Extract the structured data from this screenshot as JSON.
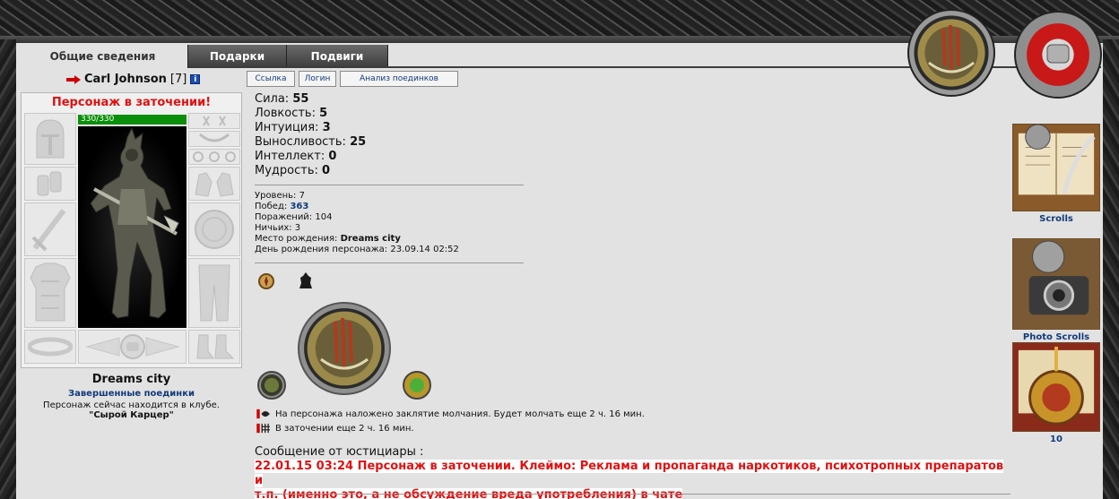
{
  "tabs": [
    {
      "label": "Общие сведения",
      "active": true
    },
    {
      "label": "Подарки",
      "active": false
    },
    {
      "label": "Подвиги",
      "active": false
    }
  ],
  "character": {
    "name": "Carl Johnson",
    "level": "[7]",
    "info_icon": "i",
    "hp": "330/330"
  },
  "buttons": {
    "link": "Ссылка",
    "login": "Логин",
    "battle_analysis": "Анализ поединков"
  },
  "jail_title": "Персонаж в заточении!",
  "city": "Dreams city",
  "finished_battles": "Завершенные поединки",
  "club_line": "Персонаж сейчас находится в клубе.",
  "club_name": "\"Сырой Карцер\"",
  "stats": [
    {
      "label": "Сила:",
      "value": "55"
    },
    {
      "label": "Ловкость:",
      "value": "5"
    },
    {
      "label": "Интуиция:",
      "value": "3"
    },
    {
      "label": "Выносливость:",
      "value": "25"
    },
    {
      "label": "Интеллект:",
      "value": "0"
    },
    {
      "label": "Мудрость:",
      "value": "0"
    }
  ],
  "info": {
    "level_label": "Уровень:",
    "level_value": "7",
    "wins_label": "Побед:",
    "wins_value": "363",
    "losses_label": "Поражений:",
    "losses_value": "104",
    "draws_label": "Ничьих:",
    "draws_value": "3",
    "birthplace_label": "Место рождения:",
    "birthplace_value": "Dreams city",
    "birthday_label": "День рождения персонажа:",
    "birthday_value": "23.09.14 02:52"
  },
  "effects": [
    "На персонажа наложено заклятие молчания. Будет молчать еще 2 ч. 16 мин.",
    "В заточении еще 2 ч. 16 мин."
  ],
  "message_label": "Сообщение от юстициары :",
  "message_line1": "22.01.15 03:24 Персонаж в заточении. Клеймо: Реклама и пропаганда наркотиков, психотропных препаратов и",
  "message_line2": "т.п. (именно это, а не обсуждение вреда употребления) в чате",
  "right_column": [
    {
      "label": "Scrolls",
      "icon": "scroll-quill-icon"
    },
    {
      "label": "Photo Scrolls",
      "icon": "camera-scroll-icon"
    },
    {
      "label": "10",
      "icon": "medal-scroll-icon"
    }
  ],
  "colors": {
    "background": "#e2e2e2",
    "accent_red": "#e01010",
    "link_blue": "#123a7a",
    "hp_green": "#0a8f0a"
  }
}
